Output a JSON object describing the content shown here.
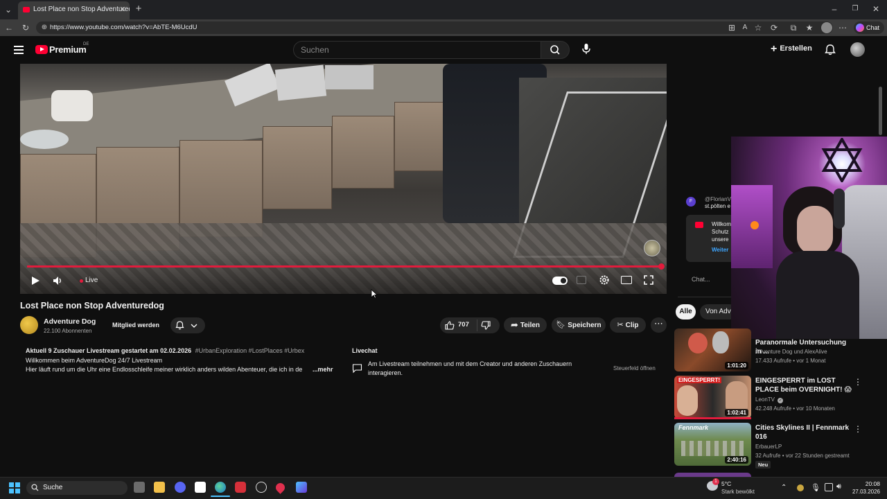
{
  "browser": {
    "tab_title": "Lost Place non Stop Adventuredog",
    "url": "https://www.youtube.com/watch?v=AbTE-M6UcdU",
    "chat_label": "Chat"
  },
  "header": {
    "logo_text": "Premium",
    "country_badge": "DE",
    "search_placeholder": "Suchen",
    "create_label": "Erstellen"
  },
  "player": {
    "live_label": "Live",
    "progress": 1.0
  },
  "video": {
    "title": "Lost Place non Stop Adventuredog",
    "channel_name": "Adventure Dog",
    "subscribers": "22.100 Abonnenten",
    "join_label": "Mitglied werden",
    "likes": "707",
    "share_label": "Teilen",
    "save_label": "Speichern",
    "clip_label": "Clip"
  },
  "description": {
    "stats": "Aktuell 9 Zuschauer  Livestream gestartet am 02.02.2026",
    "hashtags": "#UrbanExploration #LostPlaces #Urbex",
    "line1": "Willkommen beim AdventureDog 24/7 Livestream",
    "line2": "Hier läuft rund um die Uhr eine Endlosschleife meiner wirklich anders wilden Abenteuer, die ich in de",
    "more_label": "...mehr"
  },
  "livechat": {
    "title": "Livechat",
    "text": "Am Livestream teilnehmen und mit dem Creator und anderen Zuschauern interagieren.",
    "open_label": "Steuerfeld öffnen"
  },
  "chat_panel": {
    "user_initial": "F",
    "user_name": "@FlorianV",
    "user_message": "st.pölten e",
    "notice_line1": "Willkom",
    "notice_line2": "Schutz",
    "notice_line3": "unsere",
    "notice_link": "Weiter",
    "chat_placeholder": "Chat..."
  },
  "filters": {
    "all": "Alle",
    "from": "Von Adv"
  },
  "recommendations": [
    {
      "title": "Paranormale Untersuchung in ...",
      "channel": "Adventure Dog und AlexAlive",
      "meta": "17.433 Aufrufe • vor 1 Monat",
      "duration": "1:01:20"
    },
    {
      "title": "EINGESPERRT im LOST PLACE beim OVERNIGHT! 😱",
      "channel": "LeonTV",
      "meta": "42.248 Aufrufe • vor 10 Monaten",
      "duration": "1:02:41",
      "thumb_text": "EINGESPERRT!"
    },
    {
      "title": "Cities Skylines II | Fennmark 016",
      "channel": "ErbauerLP",
      "meta": "32 Aufrufe • vor 22 Stunden gestreamt",
      "duration": "2:40:16",
      "badge": "Neu",
      "thumb_text": "Fennmark"
    }
  ],
  "taskbar": {
    "search_label": "Suche",
    "weather_temp": "5°C",
    "weather_desc": "Stark bewölkt",
    "time": "20:08",
    "date": "27.03.2026",
    "notification_count": "1"
  },
  "colors": {
    "accent_red": "#e21b3c",
    "youtube_red": "#ff0033",
    "background": "#0f0f0f",
    "link_blue": "#3ea6ff"
  }
}
